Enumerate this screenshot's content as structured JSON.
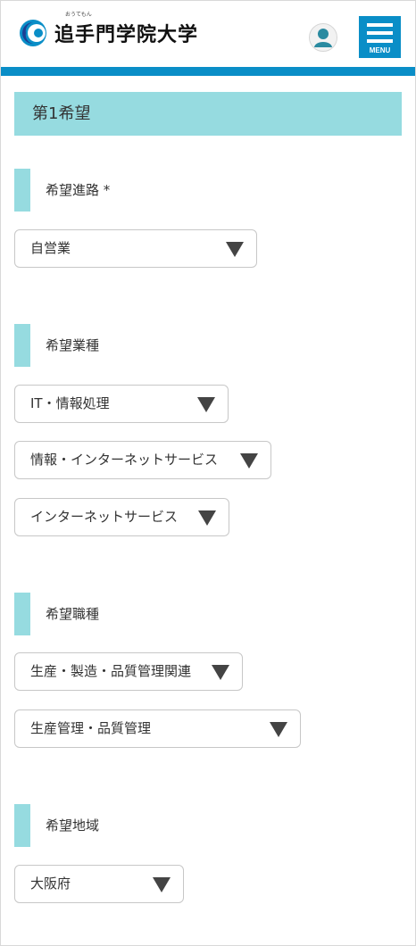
{
  "header": {
    "logo_text": "追手門学院大学",
    "logo_ruby": "おうてもん",
    "menu_label": "MENU"
  },
  "section": {
    "title": "第1希望"
  },
  "fields": {
    "course": {
      "label": "希望進路 *",
      "selects": [
        "自営業"
      ]
    },
    "industry": {
      "label": "希望業種",
      "selects": [
        "IT・情報処理",
        "情報・インターネットサービス",
        "インターネットサービス"
      ]
    },
    "occupation": {
      "label": "希望職種",
      "selects": [
        "生産・製造・品質管理関連",
        "生産管理・品質管理"
      ]
    },
    "region": {
      "label": "希望地域",
      "selects": [
        "大阪府"
      ]
    }
  },
  "colors": {
    "brand_blue": "#0a8ec7",
    "accent_teal": "#96dbe0"
  },
  "icons": {
    "logo": "university-logo-icon",
    "user": "user-icon",
    "menu": "hamburger-menu-icon",
    "select_arrow": "triangle-down-icon"
  }
}
